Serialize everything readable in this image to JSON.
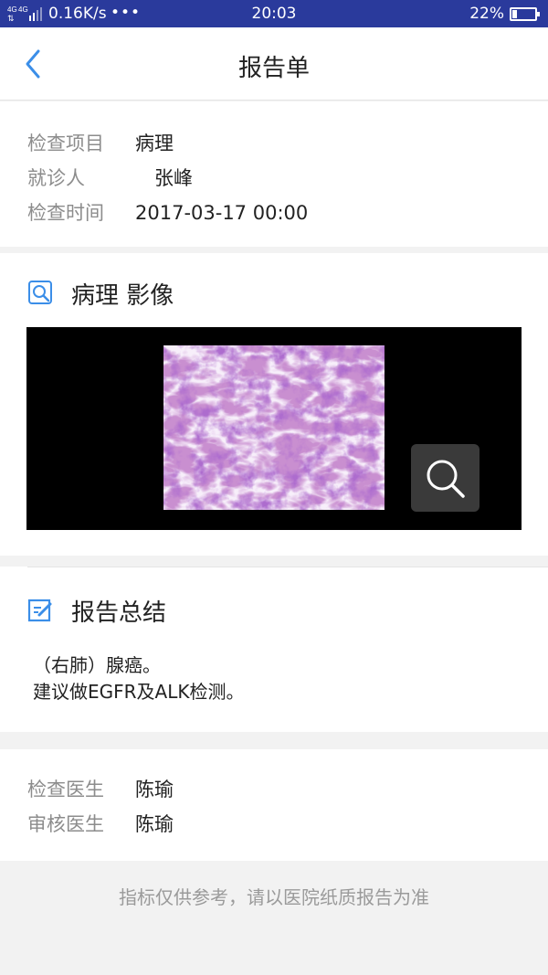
{
  "status_bar": {
    "network_type": "4G 4G",
    "speed": "0.16K/s",
    "dots": "•••",
    "time": "20:03",
    "battery": "22%",
    "battery_level": 0.22
  },
  "nav": {
    "title": "报告单",
    "back_icon": "chevron-left-icon"
  },
  "info": {
    "exam_item_label": "检查项目",
    "exam_item_value": "病理",
    "patient_label": "就诊人",
    "patient_value": "张峰",
    "exam_time_label": "检查时间",
    "exam_time_value": "2017-03-17 00:00"
  },
  "pathology": {
    "heading": "病理 影像",
    "icon": "image-search-icon",
    "zoom_icon": "magnifier-icon"
  },
  "summary": {
    "heading": "报告总结",
    "icon": "edit-icon",
    "text": "（右肺）腺癌。\n建议做EGFR及ALK检测。"
  },
  "doctors": {
    "examiner_label": "检查医生",
    "examiner_value": "陈瑜",
    "reviewer_label": "审核医生",
    "reviewer_value": "陈瑜"
  },
  "footer": {
    "note": "指标仅供参考，请以医院纸质报告为准"
  },
  "colors": {
    "status_bar": "#2a3a9c",
    "accent": "#3b8ee8",
    "label_gray": "#8c8c8c"
  }
}
